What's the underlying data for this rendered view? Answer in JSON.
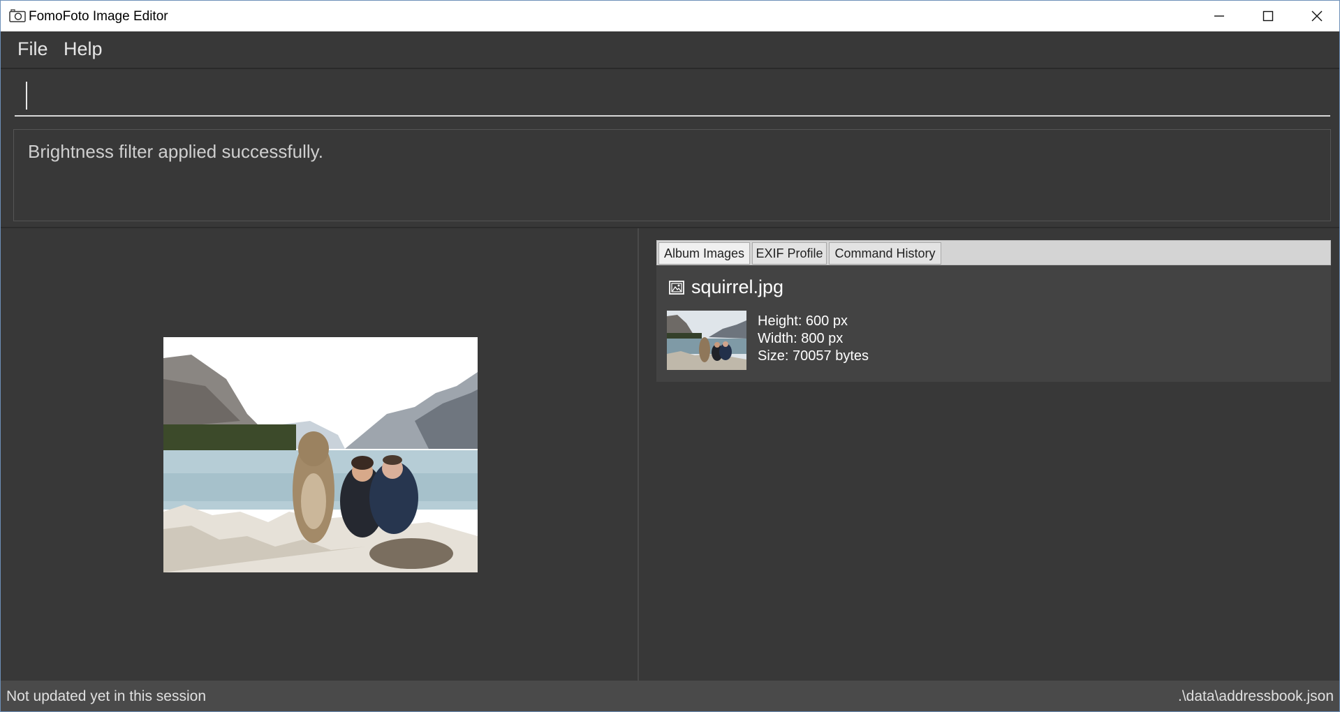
{
  "window": {
    "title": "FomoFoto Image Editor",
    "icon": "camera-icon"
  },
  "menu": {
    "file": "File",
    "help": "Help"
  },
  "command": {
    "value": "",
    "placeholder": ""
  },
  "result": {
    "message": "Brightness filter applied successfully."
  },
  "tabs": [
    {
      "label": "Album Images",
      "selected": true
    },
    {
      "label": "EXIF Profile",
      "selected": false
    },
    {
      "label": "Command History",
      "selected": false
    }
  ],
  "album": {
    "items": [
      {
        "name": "squirrel.jpg",
        "icon": "image-icon",
        "height": "Height: 600 px",
        "width": "Width: 800 px",
        "size": "Size: 70057 bytes"
      }
    ]
  },
  "status": {
    "left": "Not updated yet in this session",
    "right": ".\\data\\addressbook.json"
  },
  "colors": {
    "background": "#383838",
    "statusbar": "#4a4a4a",
    "card": "#434343"
  }
}
